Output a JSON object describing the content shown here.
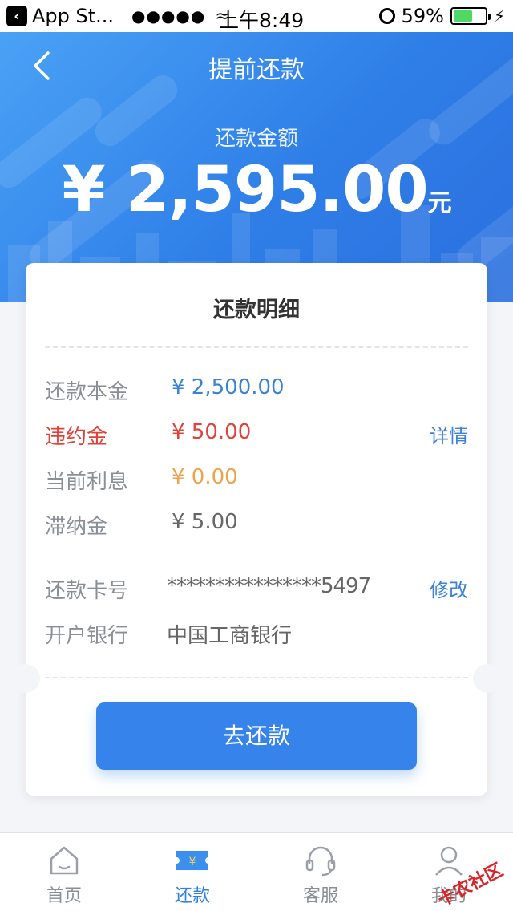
{
  "status_bar": {
    "back_app": "App St...",
    "time": "上午8:49",
    "battery": "59%"
  },
  "header": {
    "title": "提前还款",
    "amount_label": "还款金额",
    "amount": "¥ 2,595.00",
    "amount_unit": "元"
  },
  "card": {
    "title": "还款明细",
    "rows": [
      {
        "label": "还款本金",
        "value": "¥ 2,500.00",
        "label_color": "#8a8f96",
        "value_color": "#3b82d6"
      },
      {
        "label": "违约金",
        "value": "¥ 50.00",
        "link": "详情",
        "label_color": "#e0423a",
        "value_color": "#e0423a"
      },
      {
        "label": "当前利息",
        "value": "¥ 0.00",
        "label_color": "#8a8f96",
        "value_color": "#f0a24f"
      },
      {
        "label": "滞纳金",
        "value": "¥ 5.00",
        "label_color": "#8a8f96",
        "value_color": "#666666"
      }
    ],
    "card_no_label": "还款卡号",
    "card_no_value": "****************5497",
    "card_no_link": "修改",
    "bank_label": "开户银行",
    "bank_value": "中国工商银行",
    "button": "去还款"
  },
  "tabs": [
    {
      "label": "首页",
      "icon": "home-icon",
      "active": false
    },
    {
      "label": "还款",
      "icon": "ticket-icon",
      "active": true
    },
    {
      "label": "客服",
      "icon": "headset-icon",
      "active": false
    },
    {
      "label": "我的",
      "icon": "user-icon",
      "active": false
    }
  ],
  "watermark": "卡农社区"
}
